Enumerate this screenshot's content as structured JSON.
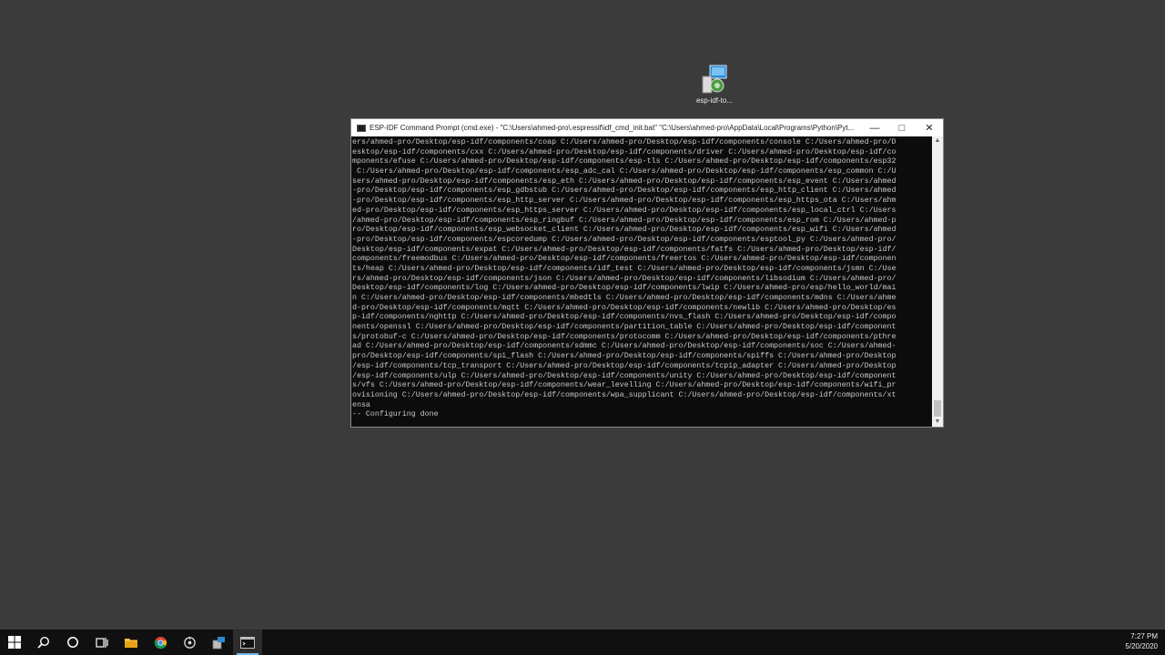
{
  "desktop": {
    "icon": {
      "label": "esp-idf-to...",
      "icon": "installer-icon"
    }
  },
  "window": {
    "title": "ESP-IDF Command Prompt (cmd.exe) - \"C:\\Users\\ahmed-pro\\.espressif\\idf_cmd_init.bat\" \"C:\\Users\\ahmed-pro\\AppData\\Local\\Programs\\Python\\Pyt...",
    "minimize_label": "—",
    "maximize_label": "□",
    "close_label": "✕",
    "lines": [
      "ers/ahmed-pro/Desktop/esp-idf/components/coap C:/Users/ahmed-pro/Desktop/esp-idf/components/console C:/Users/ahmed-pro/D",
      "esktop/esp-idf/components/cxx C:/Users/ahmed-pro/Desktop/esp-idf/components/driver C:/Users/ahmed-pro/Desktop/esp-idf/co",
      "mponents/efuse C:/Users/ahmed-pro/Desktop/esp-idf/components/esp-tls C:/Users/ahmed-pro/Desktop/esp-idf/components/esp32",
      " C:/Users/ahmed-pro/Desktop/esp-idf/components/esp_adc_cal C:/Users/ahmed-pro/Desktop/esp-idf/components/esp_common C:/U",
      "sers/ahmed-pro/Desktop/esp-idf/components/esp_eth C:/Users/ahmed-pro/Desktop/esp-idf/components/esp_event C:/Users/ahmed",
      "-pro/Desktop/esp-idf/components/esp_gdbstub C:/Users/ahmed-pro/Desktop/esp-idf/components/esp_http_client C:/Users/ahmed",
      "-pro/Desktop/esp-idf/components/esp_http_server C:/Users/ahmed-pro/Desktop/esp-idf/components/esp_https_ota C:/Users/ahm",
      "ed-pro/Desktop/esp-idf/components/esp_https_server C:/Users/ahmed-pro/Desktop/esp-idf/components/esp_local_ctrl C:/Users",
      "/ahmed-pro/Desktop/esp-idf/components/esp_ringbuf C:/Users/ahmed-pro/Desktop/esp-idf/components/esp_rom C:/Users/ahmed-p",
      "ro/Desktop/esp-idf/components/esp_websocket_client C:/Users/ahmed-pro/Desktop/esp-idf/components/esp_wifi C:/Users/ahmed",
      "-pro/Desktop/esp-idf/components/espcoredump C:/Users/ahmed-pro/Desktop/esp-idf/components/esptool_py C:/Users/ahmed-pro/",
      "Desktop/esp-idf/components/expat C:/Users/ahmed-pro/Desktop/esp-idf/components/fatfs C:/Users/ahmed-pro/Desktop/esp-idf/",
      "components/freemodbus C:/Users/ahmed-pro/Desktop/esp-idf/components/freertos C:/Users/ahmed-pro/Desktop/esp-idf/componen",
      "ts/heap C:/Users/ahmed-pro/Desktop/esp-idf/components/idf_test C:/Users/ahmed-pro/Desktop/esp-idf/components/jsmn C:/Use",
      "rs/ahmed-pro/Desktop/esp-idf/components/json C:/Users/ahmed-pro/Desktop/esp-idf/components/libsodium C:/Users/ahmed-pro/",
      "Desktop/esp-idf/components/log C:/Users/ahmed-pro/Desktop/esp-idf/components/lwip C:/Users/ahmed-pro/esp/hello_world/mai",
      "n C:/Users/ahmed-pro/Desktop/esp-idf/components/mbedtls C:/Users/ahmed-pro/Desktop/esp-idf/components/mdns C:/Users/ahme",
      "d-pro/Desktop/esp-idf/components/mqtt C:/Users/ahmed-pro/Desktop/esp-idf/components/newlib C:/Users/ahmed-pro/Desktop/es",
      "p-idf/components/nghttp C:/Users/ahmed-pro/Desktop/esp-idf/components/nvs_flash C:/Users/ahmed-pro/Desktop/esp-idf/compo",
      "nents/openssl C:/Users/ahmed-pro/Desktop/esp-idf/components/partition_table C:/Users/ahmed-pro/Desktop/esp-idf/component",
      "s/protobuf-c C:/Users/ahmed-pro/Desktop/esp-idf/components/protocomm C:/Users/ahmed-pro/Desktop/esp-idf/components/pthre",
      "ad C:/Users/ahmed-pro/Desktop/esp-idf/components/sdmmc C:/Users/ahmed-pro/Desktop/esp-idf/components/soc C:/Users/ahmed-",
      "pro/Desktop/esp-idf/components/spi_flash C:/Users/ahmed-pro/Desktop/esp-idf/components/spiffs C:/Users/ahmed-pro/Desktop",
      "/esp-idf/components/tcp_transport C:/Users/ahmed-pro/Desktop/esp-idf/components/tcpip_adapter C:/Users/ahmed-pro/Desktop",
      "/esp-idf/components/ulp C:/Users/ahmed-pro/Desktop/esp-idf/components/unity C:/Users/ahmed-pro/Desktop/esp-idf/component",
      "s/vfs C:/Users/ahmed-pro/Desktop/esp-idf/components/wear_levelling C:/Users/ahmed-pro/Desktop/esp-idf/components/wifi_pr",
      "ovisioning C:/Users/ahmed-pro/Desktop/esp-idf/components/wpa_supplicant C:/Users/ahmed-pro/Desktop/esp-idf/components/xt",
      "ensa",
      "-- Configuring done"
    ]
  },
  "taskbar": {
    "items": [
      {
        "icon": "windows-start-icon",
        "active": false
      },
      {
        "icon": "search-icon",
        "active": false
      },
      {
        "icon": "cortana-icon",
        "active": false
      },
      {
        "icon": "task-view-icon",
        "active": false
      },
      {
        "icon": "file-explorer-icon",
        "active": false
      },
      {
        "icon": "chrome-icon",
        "active": false
      },
      {
        "icon": "settings-app-icon",
        "active": false
      },
      {
        "icon": "installer-app-icon",
        "active": false
      },
      {
        "icon": "command-prompt-icon",
        "active": true
      }
    ],
    "clock": {
      "time": "7:27 PM",
      "date": "5/20/2020"
    }
  }
}
